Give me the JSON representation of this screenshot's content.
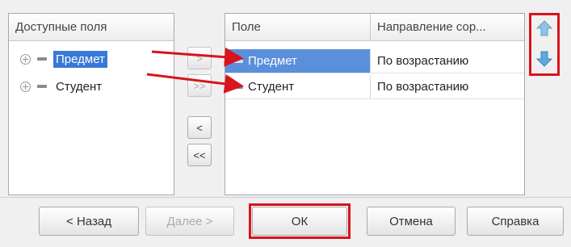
{
  "available_fields": {
    "header": "Доступные поля",
    "items": [
      {
        "label": "Предмет",
        "selected": true
      },
      {
        "label": "Студент",
        "selected": false
      }
    ]
  },
  "sort_grid": {
    "col_field": "Поле",
    "col_direction": "Направление сор...",
    "rows": [
      {
        "field": "Предмет",
        "direction": "По возрастанию"
      },
      {
        "field": "Студент",
        "direction": "По возрастанию"
      }
    ]
  },
  "move_buttons": {
    "add": ">",
    "add_all": ">>",
    "remove": "<",
    "remove_all": "<<"
  },
  "footer": {
    "back": "< Назад",
    "next": "Далее >",
    "ok": "ОК",
    "cancel": "Отмена",
    "help": "Справка"
  },
  "colors": {
    "annotation_red": "#d8141c",
    "selection_blue": "#3a78d8"
  }
}
